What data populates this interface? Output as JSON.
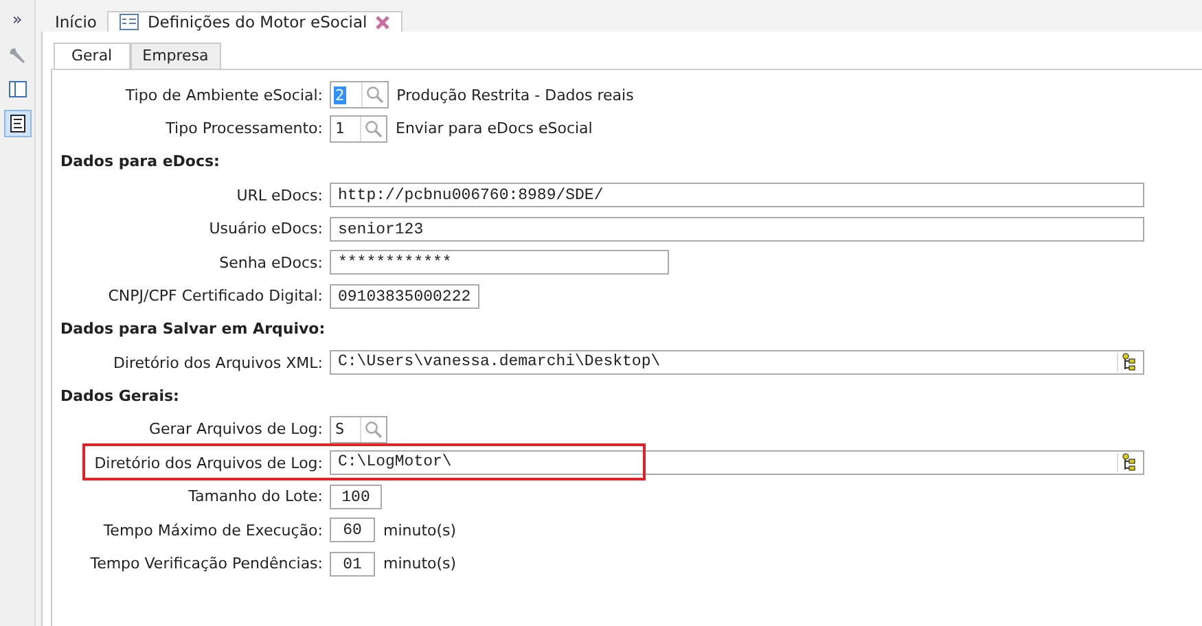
{
  "sidebar": {
    "toggle": "»",
    "items": [
      {
        "kind": "wrench",
        "selected": false
      },
      {
        "kind": "window",
        "selected": false
      },
      {
        "kind": "form",
        "selected": true
      }
    ]
  },
  "tabs": [
    {
      "label": "Início",
      "selected": false,
      "closable": false
    },
    {
      "label": "Definições do Motor eSocial",
      "selected": true,
      "closable": true
    }
  ],
  "subtabs": [
    {
      "label": "Geral",
      "selected": true
    },
    {
      "label": "Empresa",
      "selected": false
    }
  ],
  "rows": [
    {
      "kind": "lookup",
      "label": "Tipo de Ambiente eSocial:",
      "value": "2",
      "selected": true,
      "description": "Produção Restrita - Dados reais"
    },
    {
      "kind": "lookup",
      "label": "Tipo Processamento:",
      "value": "1",
      "selected": false,
      "description": "Enviar para eDocs eSocial"
    },
    {
      "kind": "heading",
      "label": "Dados para eDocs:"
    },
    {
      "kind": "long-text",
      "label": "URL eDocs:",
      "value": "http://pcbnu006760:8989/SDE/"
    },
    {
      "kind": "long-text",
      "label": "Usuário eDocs:",
      "value": "senior123"
    },
    {
      "kind": "medium-text",
      "label": "Senha eDocs:",
      "value": "************"
    },
    {
      "kind": "short-text",
      "label": "CNPJ/CPF Certificado Digital:",
      "value": "09103835000222"
    },
    {
      "kind": "heading",
      "label": "Dados para Salvar em Arquivo:"
    },
    {
      "kind": "path",
      "label": "Diretório dos Arquivos XML:",
      "value": "C:\\Users\\vanessa.demarchi\\Desktop\\",
      "highlighted": false
    },
    {
      "kind": "heading",
      "label": "Dados Gerais:"
    },
    {
      "kind": "lookup",
      "label": "Gerar Arquivos de Log:",
      "value": "S",
      "selected": false
    },
    {
      "kind": "path",
      "label": "Diretório dos Arquivos de Log:",
      "value": "C:\\LogMotor\\",
      "highlighted": true
    },
    {
      "kind": "number",
      "label": "Tamanho do Lote:",
      "value": "100"
    },
    {
      "kind": "number",
      "label": "Tempo Máximo de Execução:",
      "value": "60",
      "unit": "minuto(s)"
    },
    {
      "kind": "number",
      "label": "Tempo Verificação Pendências:",
      "value": "01",
      "unit": "minuto(s)"
    }
  ]
}
